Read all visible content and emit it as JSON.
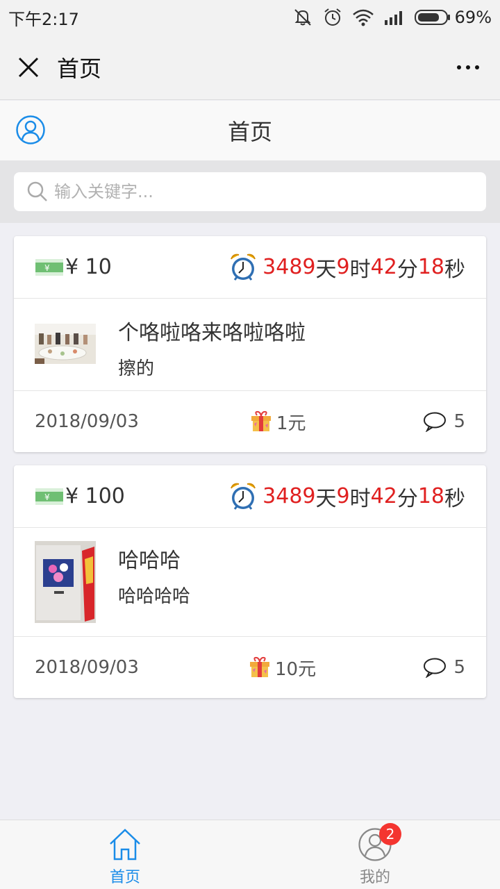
{
  "status_bar": {
    "time": "下午2:17",
    "battery": "69%"
  },
  "nav": {
    "title": "首页"
  },
  "page_header": {
    "title": "首页"
  },
  "search": {
    "placeholder": "输入关键字..."
  },
  "cards": [
    {
      "amount": "¥ 10",
      "countdown": {
        "days": "3489",
        "days_unit": "天",
        "hours": "9",
        "hours_unit": "时",
        "minutes": "42",
        "minutes_unit": "分",
        "seconds": "18",
        "seconds_unit": "秒"
      },
      "title": "个咯啦咯来咯啦咯啦",
      "subtitle": "擦的",
      "date": "2018/09/03",
      "reward": "1元",
      "comments": "5"
    },
    {
      "amount": "¥ 100",
      "countdown": {
        "days": "3489",
        "days_unit": "天",
        "hours": "9",
        "hours_unit": "时",
        "minutes": "42",
        "minutes_unit": "分",
        "seconds": "18",
        "seconds_unit": "秒"
      },
      "title": "哈哈哈",
      "subtitle": "哈哈哈哈",
      "date": "2018/09/03",
      "reward": "10元",
      "comments": "5"
    }
  ],
  "tabbar": {
    "home_label": "首页",
    "mine_label": "我的",
    "mine_badge": "2",
    "active_color": "#1a8ce8",
    "inactive_color": "#888888"
  },
  "colors": {
    "countdown_number": "#e02020",
    "accent": "#1a8ce8"
  }
}
